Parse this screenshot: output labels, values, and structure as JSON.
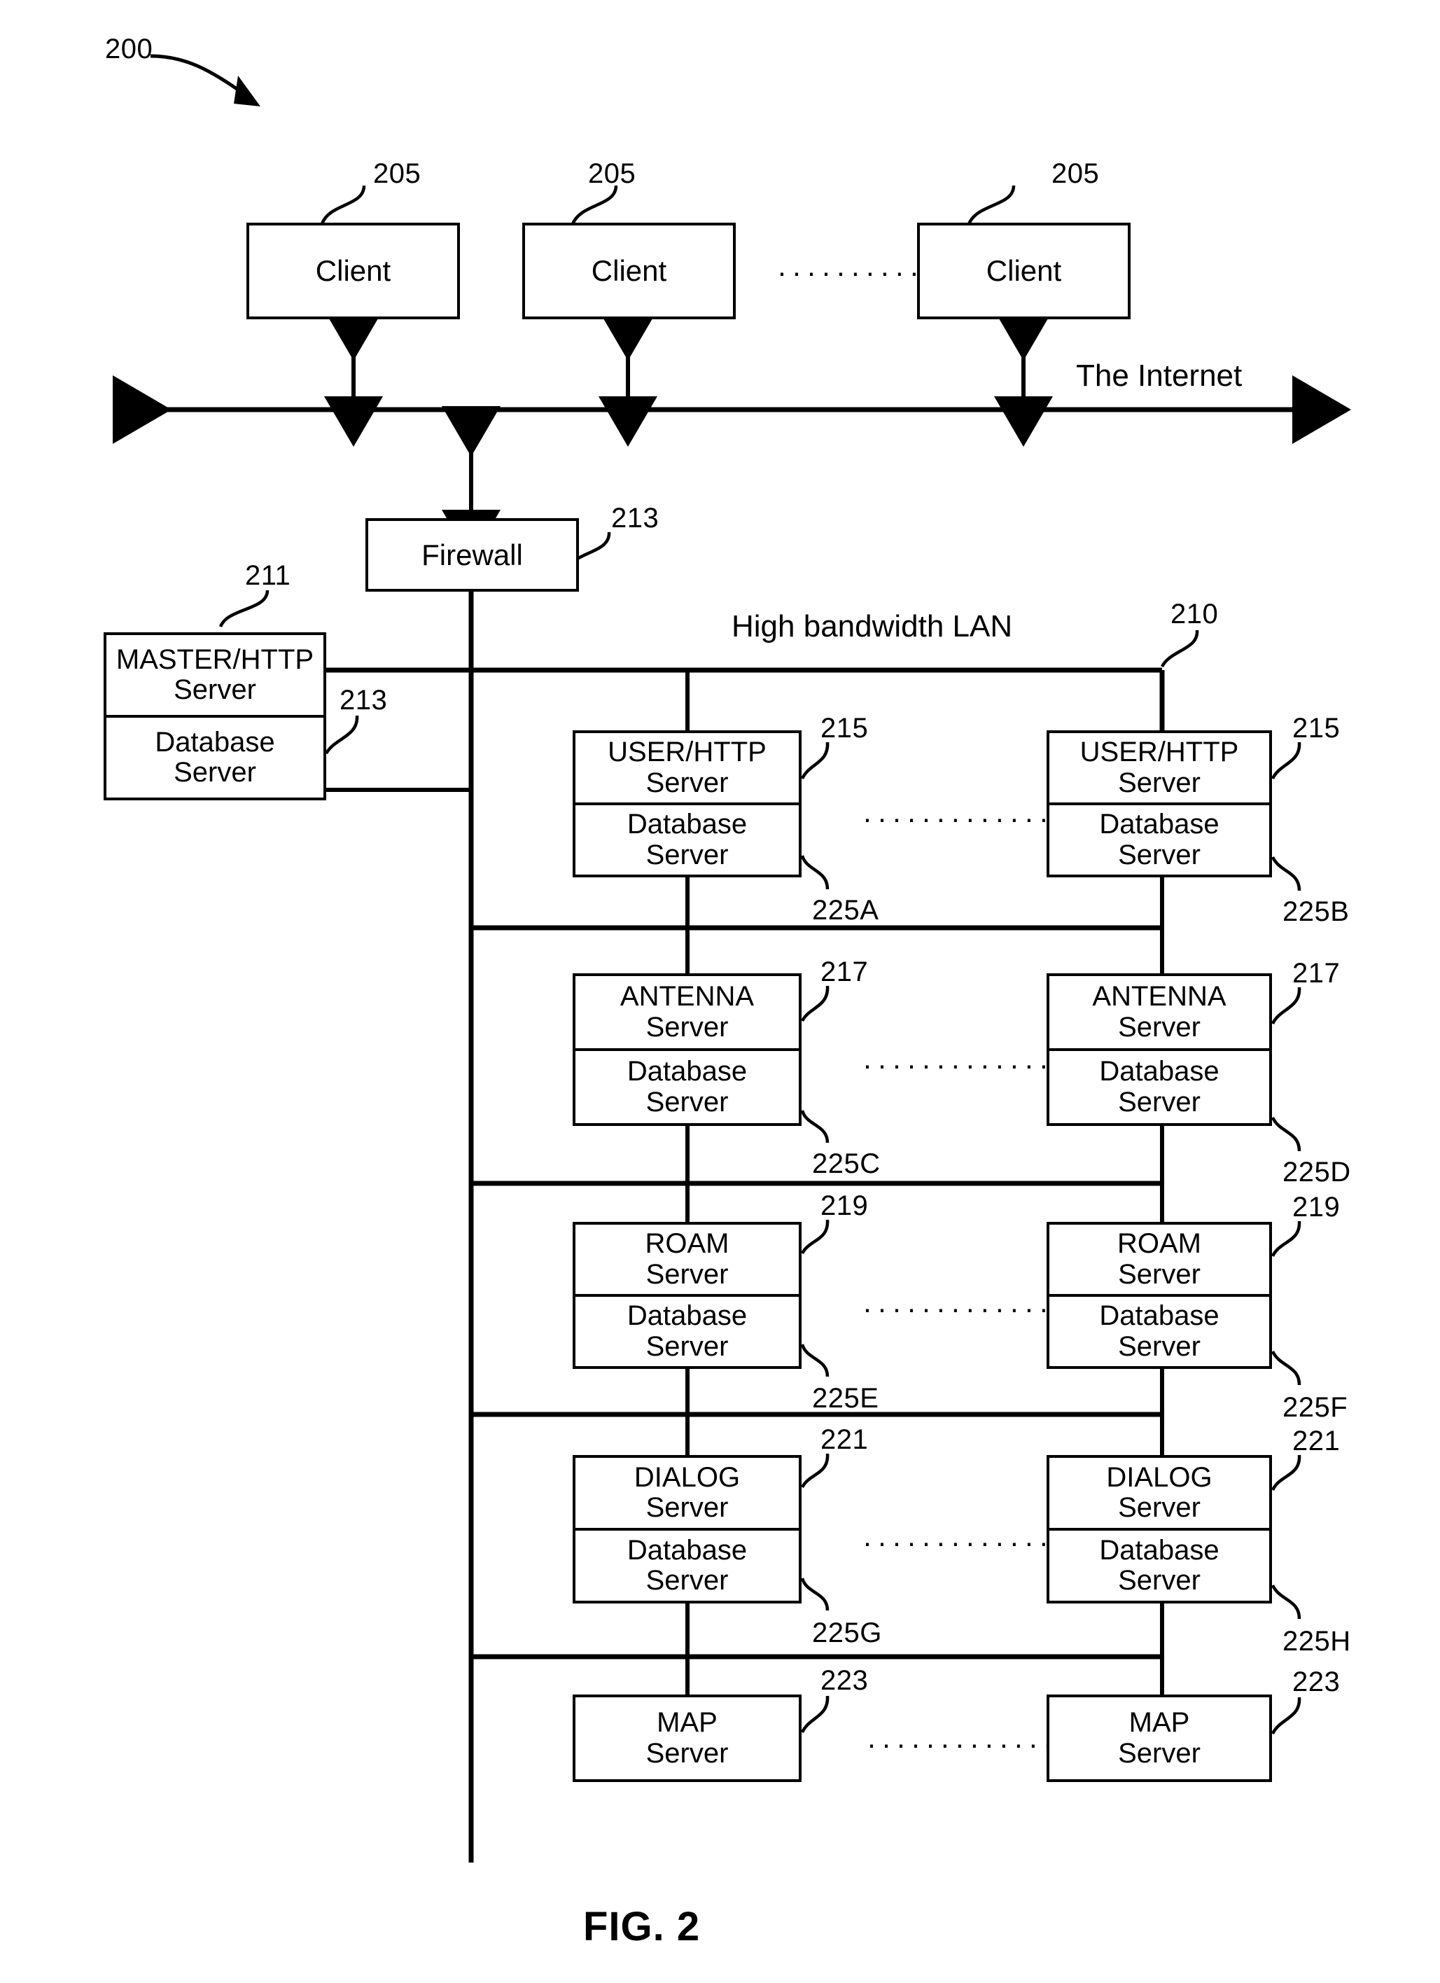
{
  "figure": {
    "caption": "FIG. 2",
    "system_ref": "200"
  },
  "internet": {
    "label": "The Internet",
    "clients": [
      {
        "label": "Client",
        "ref": "205"
      },
      {
        "label": "Client",
        "ref": "205"
      },
      {
        "label": "Client",
        "ref": "205"
      }
    ],
    "ellipsis": "··········"
  },
  "firewall": {
    "label": "Firewall",
    "ref": "213"
  },
  "lan": {
    "label": "High bandwidth LAN",
    "ref": "210"
  },
  "master": {
    "title": "MASTER/HTTP",
    "subtitle": "Server",
    "db_title": "Database",
    "db_subtitle": "Server",
    "ref": "211",
    "db_ref": "213"
  },
  "rows": [
    {
      "name": "user-http",
      "title": "USER/HTTP",
      "subtitle": "Server",
      "has_db": true,
      "db_title": "Database",
      "db_subtitle": "Server",
      "left_ref": "215",
      "right_ref": "215",
      "left_db_ref": "225A",
      "right_db_ref": "225B",
      "ellipsis": "···············"
    },
    {
      "name": "antenna",
      "title": "ANTENNA",
      "subtitle": "Server",
      "has_db": true,
      "db_title": "Database",
      "db_subtitle": "Server",
      "left_ref": "217",
      "right_ref": "217",
      "left_db_ref": "225C",
      "right_db_ref": "225D",
      "ellipsis": "···············"
    },
    {
      "name": "roam",
      "title": "ROAM",
      "subtitle": "Server",
      "has_db": true,
      "db_title": "Database",
      "db_subtitle": "Server",
      "left_ref": "219",
      "right_ref": "219",
      "left_db_ref": "225E",
      "right_db_ref": "225F",
      "ellipsis": "···············"
    },
    {
      "name": "dialog",
      "title": "DIALOG",
      "subtitle": "Server",
      "has_db": true,
      "db_title": "Database",
      "db_subtitle": "Server",
      "left_ref": "221",
      "right_ref": "221",
      "left_db_ref": "225G",
      "right_db_ref": "225H",
      "ellipsis": "···············"
    },
    {
      "name": "map",
      "title": "MAP",
      "subtitle": "Server",
      "has_db": false,
      "left_ref": "223",
      "right_ref": "223",
      "ellipsis": "··············"
    }
  ]
}
